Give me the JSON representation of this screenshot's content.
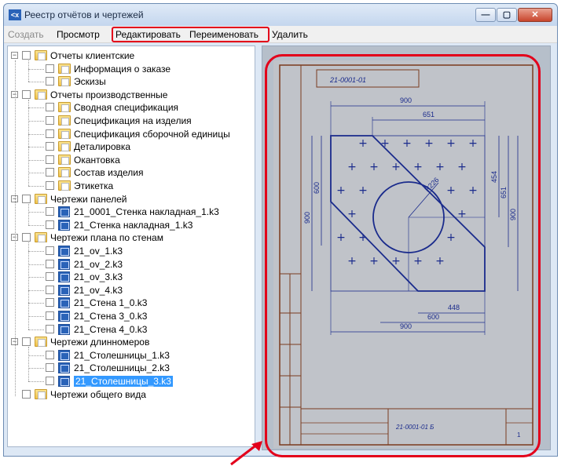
{
  "window": {
    "title": "Реестр отчётов и чертежей",
    "min_glyph": "—",
    "max_glyph": "▢",
    "close_glyph": "✕"
  },
  "menu": [
    {
      "label": "Создать",
      "enabled": false
    },
    {
      "label": "Просмотр",
      "enabled": true
    },
    {
      "label": "Редактировать",
      "enabled": true
    },
    {
      "label": "Переименовать",
      "enabled": true
    },
    {
      "label": "Удалить",
      "enabled": true
    }
  ],
  "tree": [
    {
      "label": "Отчеты клиентские",
      "level": 0,
      "type": "folder",
      "expanded": true
    },
    {
      "label": "Информация о заказе",
      "level": 1,
      "type": "folder"
    },
    {
      "label": "Эскизы",
      "level": 1,
      "type": "folder"
    },
    {
      "label": "Отчеты производственные",
      "level": 0,
      "type": "folder",
      "expanded": true
    },
    {
      "label": "Сводная спецификация",
      "level": 1,
      "type": "folder"
    },
    {
      "label": "Спецификация на изделия",
      "level": 1,
      "type": "folder"
    },
    {
      "label": "Спецификация сборочной единицы",
      "level": 1,
      "type": "folder"
    },
    {
      "label": "Деталировка",
      "level": 1,
      "type": "folder"
    },
    {
      "label": "Окантовка",
      "level": 1,
      "type": "folder"
    },
    {
      "label": "Состав изделия",
      "level": 1,
      "type": "folder"
    },
    {
      "label": "Этикетка",
      "level": 1,
      "type": "folder"
    },
    {
      "label": "Чертежи панелей",
      "level": 0,
      "type": "folder",
      "expanded": true
    },
    {
      "label": "21_0001_Стенка накладная_1.k3",
      "level": 1,
      "type": "file"
    },
    {
      "label": "21_Стенка накладная_1.k3",
      "level": 1,
      "type": "file"
    },
    {
      "label": "Чертежи плана по стенам",
      "level": 0,
      "type": "folder",
      "expanded": true
    },
    {
      "label": "21_ov_1.k3",
      "level": 1,
      "type": "file"
    },
    {
      "label": "21_ov_2.k3",
      "level": 1,
      "type": "file"
    },
    {
      "label": "21_ov_3.k3",
      "level": 1,
      "type": "file"
    },
    {
      "label": "21_ov_4.k3",
      "level": 1,
      "type": "file"
    },
    {
      "label": "21_Стена 1_0.k3",
      "level": 1,
      "type": "file"
    },
    {
      "label": "21_Стена 3_0.k3",
      "level": 1,
      "type": "file"
    },
    {
      "label": "21_Стена 4_0.k3",
      "level": 1,
      "type": "file"
    },
    {
      "label": "Чертежи длинномеров",
      "level": 0,
      "type": "folder",
      "expanded": true
    },
    {
      "label": "21_Столешницы_1.k3",
      "level": 1,
      "type": "file"
    },
    {
      "label": "21_Столешницы_2.k3",
      "level": 1,
      "type": "file"
    },
    {
      "label": "21_Столешницы_3.k3",
      "level": 1,
      "type": "file",
      "selected": true
    },
    {
      "label": "Чертежи общего вида",
      "level": 0,
      "type": "folder",
      "expanded": false
    }
  ],
  "drawing": {
    "code": "21-0001-01",
    "dims": {
      "top_outer": "900",
      "top_inner": "651",
      "left_outer": "900",
      "left_inner": "600",
      "right_a": "454",
      "right_b": "651",
      "right_c": "900",
      "bottom_a": "448",
      "bottom_b": "600",
      "bottom_c": "900",
      "radius": "R226"
    },
    "stamp_code": "21-0001-01 Б",
    "sheet": "1"
  },
  "colors": {
    "highlight": "#e3001b",
    "drawing_line": "#1a2b8c",
    "frame_line": "#7a3b1e",
    "selection": "#3399ff"
  }
}
